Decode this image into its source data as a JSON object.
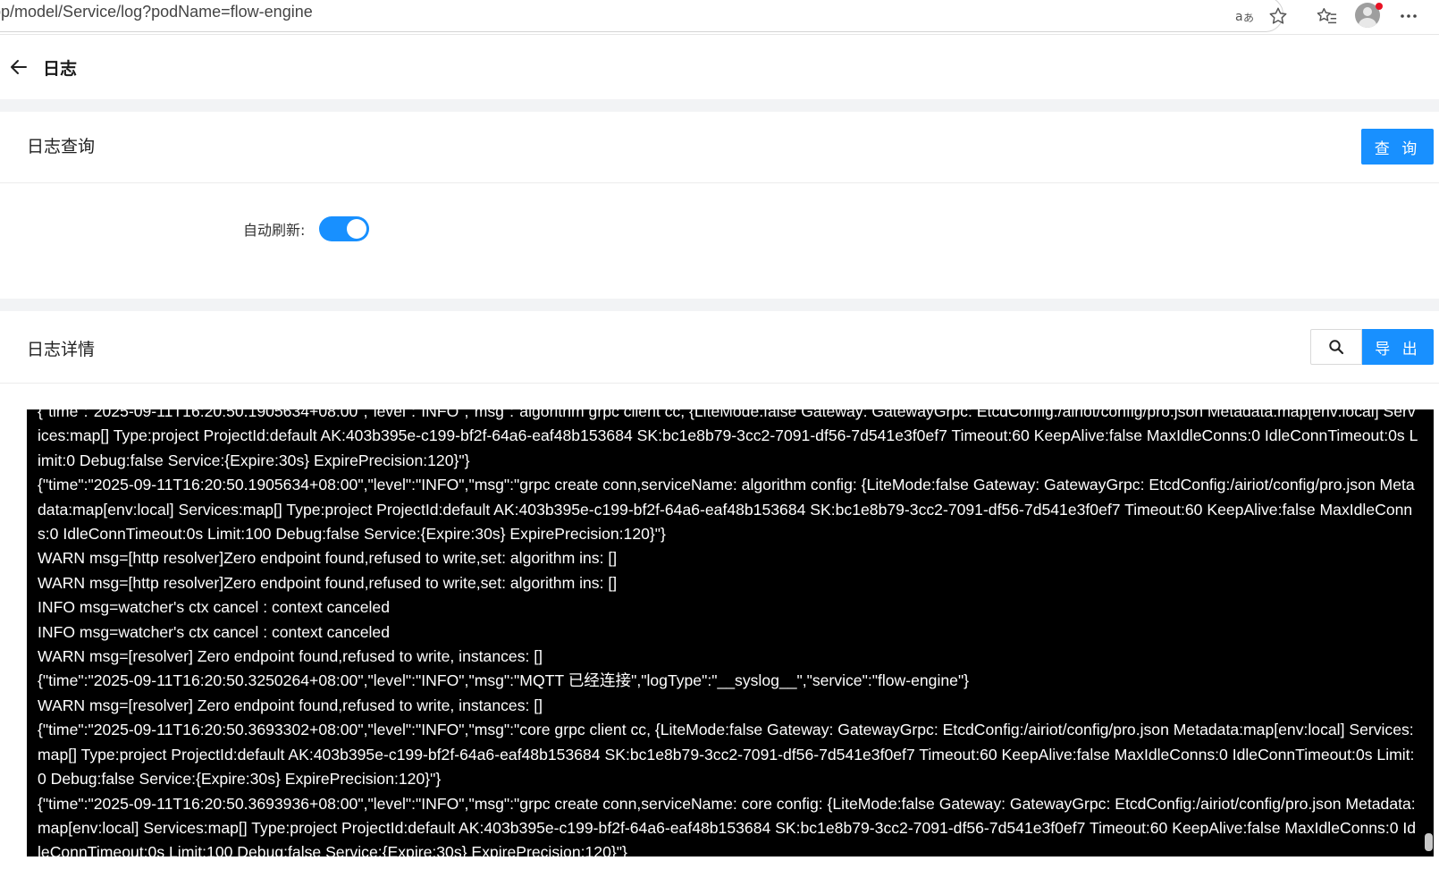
{
  "browser": {
    "url": "app/model/Service/log?podName=flow-engine"
  },
  "header": {
    "title": "日志"
  },
  "query_card": {
    "title": "日志查询",
    "query_button": "查 询",
    "auto_refresh_label": "自动刷新:",
    "auto_refresh_on": true
  },
  "detail_card": {
    "title": "日志详情",
    "export_button": "导 出"
  },
  "colors": {
    "primary": "#1890ff",
    "log_bg": "#000000",
    "log_text": "#ffffff"
  },
  "logs": [
    "{\"time\":\"2025-09-11T16:20:50.1905634+08:00\",\"level\":\"INFO\",\"msg\":\"algorithm grpc client cc, {LiteMode:false Gateway: GatewayGrpc: EtcdConfig:/airiot/config/pro.json Metadata:map[env:local] Services:map[] Type:project ProjectId:default AK:403b395e-c199-bf2f-64a6-eaf48b153684 SK:bc1e8b79-3cc2-7091-df56-7d541e3f0ef7 Timeout:60 KeepAlive:false MaxIdleConns:0 IdleConnTimeout:0s Limit:0 Debug:false Service:{Expire:30s} ExpirePrecision:120}\"}",
    "{\"time\":\"2025-09-11T16:20:50.1905634+08:00\",\"level\":\"INFO\",\"msg\":\"grpc create conn,serviceName: algorithm config: {LiteMode:false Gateway: GatewayGrpc: EtcdConfig:/airiot/config/pro.json Metadata:map[env:local] Services:map[] Type:project ProjectId:default AK:403b395e-c199-bf2f-64a6-eaf48b153684 SK:bc1e8b79-3cc2-7091-df56-7d541e3f0ef7 Timeout:60 KeepAlive:false MaxIdleConns:0 IdleConnTimeout:0s Limit:100 Debug:false Service:{Expire:30s} ExpirePrecision:120}\"}",
    "WARN msg=[http resolver]Zero endpoint found,refused to write,set: algorithm ins: []",
    "WARN msg=[http resolver]Zero endpoint found,refused to write,set: algorithm ins: []",
    "INFO msg=watcher's ctx cancel : context canceled",
    "INFO msg=watcher's ctx cancel : context canceled",
    "WARN msg=[resolver] Zero endpoint found,refused to write, instances: []",
    "{\"time\":\"2025-09-11T16:20:50.3250264+08:00\",\"level\":\"INFO\",\"msg\":\"MQTT 已经连接\",\"logType\":\"__syslog__\",\"service\":\"flow-engine\"}",
    "WARN msg=[resolver] Zero endpoint found,refused to write, instances: []",
    "{\"time\":\"2025-09-11T16:20:50.3693302+08:00\",\"level\":\"INFO\",\"msg\":\"core grpc client cc, {LiteMode:false Gateway: GatewayGrpc: EtcdConfig:/airiot/config/pro.json Metadata:map[env:local] Services:map[] Type:project ProjectId:default AK:403b395e-c199-bf2f-64a6-eaf48b153684 SK:bc1e8b79-3cc2-7091-df56-7d541e3f0ef7 Timeout:60 KeepAlive:false MaxIdleConns:0 IdleConnTimeout:0s Limit:0 Debug:false Service:{Expire:30s} ExpirePrecision:120}\"}",
    "{\"time\":\"2025-09-11T16:20:50.3693936+08:00\",\"level\":\"INFO\",\"msg\":\"grpc create conn,serviceName: core config: {LiteMode:false Gateway: GatewayGrpc: EtcdConfig:/airiot/config/pro.json Metadata:map[env:local] Services:map[] Type:project ProjectId:default AK:403b395e-c199-bf2f-64a6-eaf48b153684 SK:bc1e8b79-3cc2-7091-df56-7d541e3f0ef7 Timeout:60 KeepAlive:false MaxIdleConns:0 IdleConnTimeout:0s Limit:100 Debug:false Service:{Expire:30s} ExpirePrecision:120}\"}"
  ]
}
